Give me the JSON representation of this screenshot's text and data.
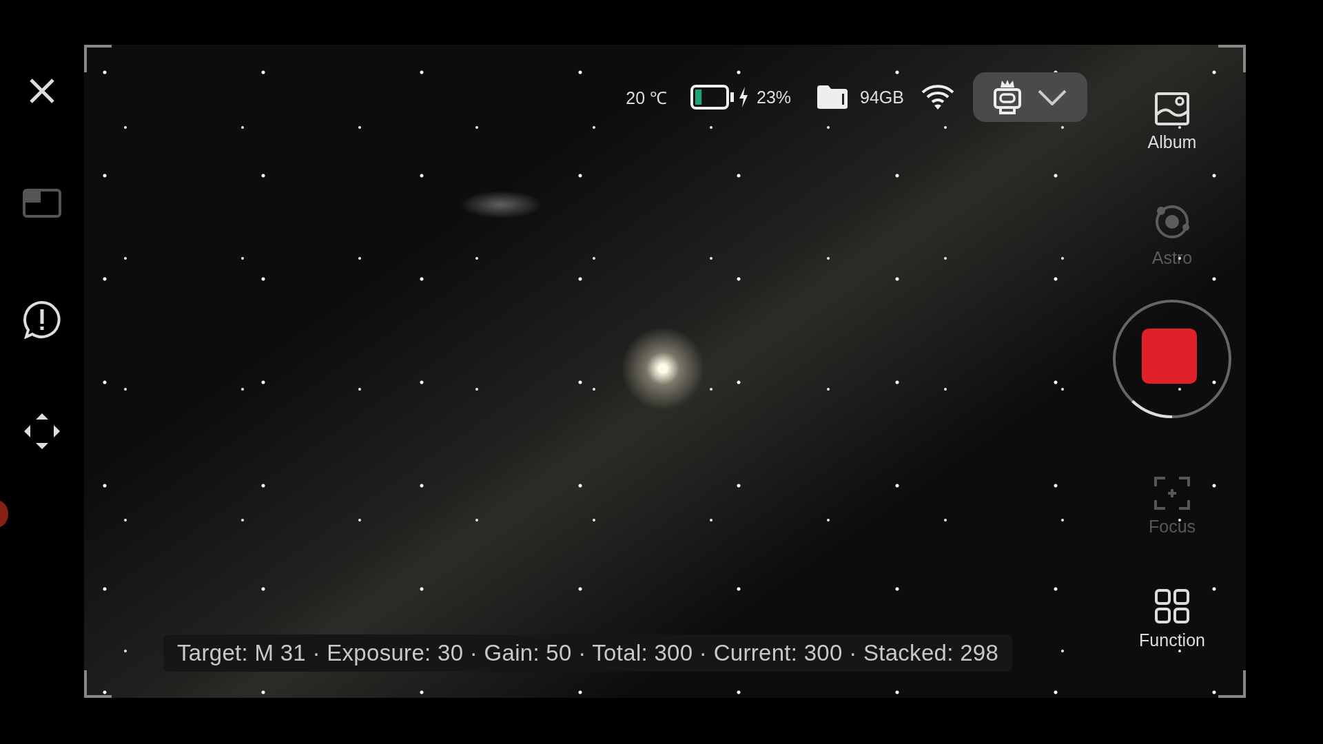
{
  "left_toolbar": {
    "tools": [
      {
        "kind": "close"
      },
      {
        "kind": "window"
      },
      {
        "kind": "feedback"
      },
      {
        "kind": "move"
      }
    ]
  },
  "status_bar": {
    "temperature": "20 ℃",
    "battery": {
      "level": 0.23,
      "charging": true,
      "reading": "23%"
    },
    "storage": "94GB",
    "device_menu": {
      "expanded": false
    }
  },
  "side_controls": [
    {
      "kind": "album",
      "label": "Album",
      "disabled": false
    },
    {
      "kind": "astro",
      "label": "Astro",
      "disabled": true
    },
    {
      "kind": "record",
      "recording": true,
      "level": 0.12
    },
    {
      "kind": "focus",
      "label": "Focus",
      "disabled": true
    },
    {
      "kind": "function",
      "label": "Function",
      "disabled": false
    }
  ],
  "info_bar": "Target: M 31 · Exposure: 30 · Gain: 50 · Total: 300 · Current: 300 · Stacked: 298"
}
